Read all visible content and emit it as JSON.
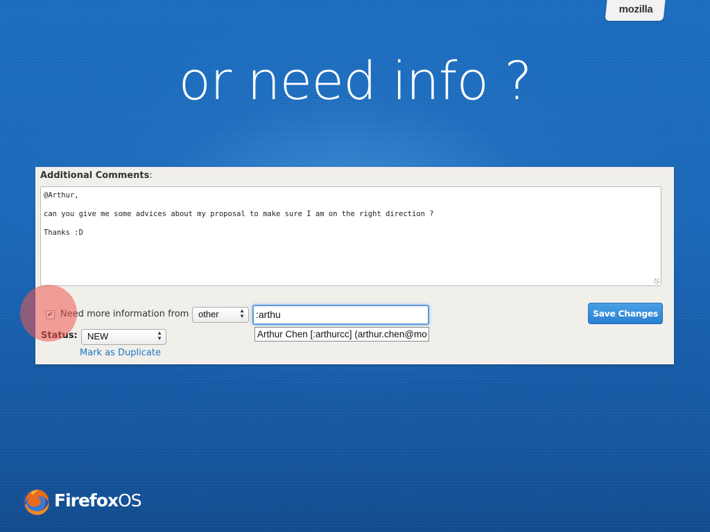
{
  "slide": {
    "title": "or need info ?",
    "brand_tab": "mozilla",
    "footer_brand": "Firefox",
    "footer_os": "OS"
  },
  "form": {
    "comments_label": "Additional Comments",
    "comments_colon": ":",
    "comment_lines": [
      "@Arthur,",
      "can you give me some advices about my proposal to make sure I am on the right direction ?",
      "Thanks :D"
    ],
    "needinfo_checked": true,
    "needinfo_label": "Need more information from",
    "needinfo_select_value": "other",
    "needinfo_input_value": ":arthu",
    "autocomplete_suggestion": "Arthur Chen [:arthurcc] (arthur.chen@mo",
    "status_label": "Status:",
    "status_select_value": "NEW",
    "mark_duplicate_link": "Mark as Duplicate",
    "save_button": "Save Changes"
  },
  "colors": {
    "background": "#1b69bb",
    "panel": "#f1efea",
    "save_button": "#2a7fcf",
    "link": "#1a78c2",
    "highlight": "#ec5a50"
  },
  "icons": {
    "checkbox": "checkmark-icon",
    "select_arrows": "updown-arrows-icon",
    "logo": "firefox-logo-icon"
  }
}
